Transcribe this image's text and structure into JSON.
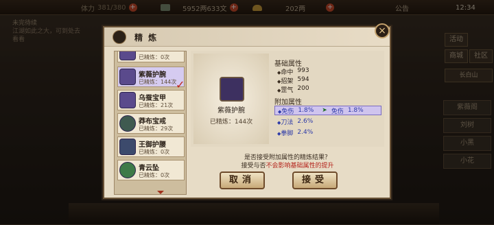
{
  "topbar": {
    "stamina_label": "体力",
    "stamina_value": "381/380",
    "money": "5952两633文",
    "gold": "202两",
    "announce": "公告",
    "time": "12:34"
  },
  "left_panel": {
    "title": "未完待续",
    "text": "江湖如此之大，可到处去看看"
  },
  "right_panel": {
    "buttons": [
      "活动",
      "商城",
      "社区"
    ],
    "location": "长白山",
    "slots": [
      "紫薇阁",
      "刘树",
      "小黑",
      "小花"
    ]
  },
  "dialog": {
    "title": "精 炼",
    "close": "×",
    "list": [
      {
        "name": "",
        "count": "已精炼：0次"
      },
      {
        "name": "紫薇护腕",
        "count": "已精炼：144次",
        "selected": true
      },
      {
        "name": "乌蚕宝甲",
        "count": "已精炼：21次"
      },
      {
        "name": "莽布宝戒",
        "count": "已精炼：29次"
      },
      {
        "name": "王御护腰",
        "count": "已精炼：0次"
      },
      {
        "name": "青云坠",
        "count": "已精炼：0次"
      }
    ],
    "preview": {
      "name": "紫薇护腕",
      "count": "已精炼：144次"
    },
    "base_title": "基础属性",
    "base_attrs": [
      {
        "k": "命中",
        "v": "993"
      },
      {
        "k": "招架",
        "v": "594"
      },
      {
        "k": "罡气",
        "v": "200"
      }
    ],
    "extra_title": "附加属性",
    "extra_attrs": [
      {
        "k": "免伤",
        "v": "1.8%",
        "new_k": "免伤",
        "new_v": "1.8%"
      },
      {
        "k": "刀法",
        "v": "2.6%"
      },
      {
        "k": "拳脚",
        "v": "2.4%"
      }
    ],
    "prompt_line1": "是否接受附加属性的精炼结果？",
    "prompt_line2_a": "接受与否",
    "prompt_line2_red": "不会影响基础属性的提升",
    "cancel": "取消",
    "accept": "接受"
  }
}
